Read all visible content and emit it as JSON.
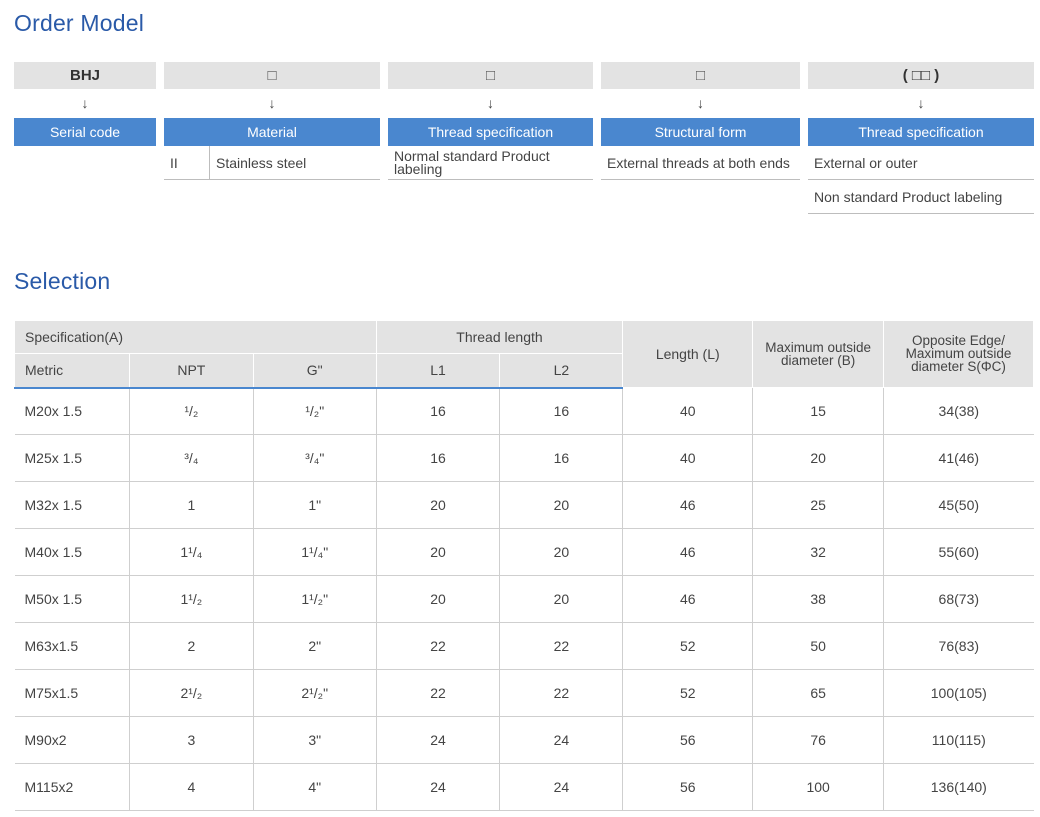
{
  "order_model": {
    "title": "Order Model",
    "columns": [
      {
        "code": "BHJ",
        "arrow": "↓",
        "header": "Serial code",
        "rows": []
      },
      {
        "code": "□",
        "arrow": "↓",
        "header": "Material",
        "rows": [
          {
            "key": "II",
            "value": "Stainless steel"
          }
        ]
      },
      {
        "code": "□",
        "arrow": "↓",
        "header": "Thread specification",
        "rows": [
          {
            "value": "Normal standard Product labeling"
          }
        ]
      },
      {
        "code": "□",
        "arrow": "↓",
        "header": "Structural form",
        "rows": [
          {
            "value": "External threads at both ends"
          }
        ]
      },
      {
        "code": "( □□ )",
        "arrow": "↓",
        "header": "Thread specification",
        "rows": [
          {
            "value": "External or outer"
          },
          {
            "value": "Non standard Product labeling"
          }
        ]
      }
    ]
  },
  "selection": {
    "title": "Selection",
    "headers": {
      "spec": "Specification(A)",
      "thread_length": "Thread length",
      "length": "Length (L)",
      "max_outside": "Maximum outside diameter (B)",
      "opposite": "Opposite Edge/ Maximum outside diameter S(ΦC)",
      "metric": "Metric",
      "npt": "NPT",
      "g": "G\"",
      "l1": "L1",
      "l2": "L2"
    },
    "rows": [
      {
        "metric": "M20x 1.5",
        "npt": "¹/₂",
        "g": "¹/₂\"",
        "l1": "16",
        "l2": "16",
        "length": "40",
        "b": "15",
        "s": "34(38)"
      },
      {
        "metric": "M25x 1.5",
        "npt": "³/₄",
        "g": "³/₄\"",
        "l1": "16",
        "l2": "16",
        "length": "40",
        "b": "20",
        "s": "41(46)"
      },
      {
        "metric": "M32x 1.5",
        "npt": "1",
        "g": "1\"",
        "l1": "20",
        "l2": "20",
        "length": "46",
        "b": "25",
        "s": "45(50)"
      },
      {
        "metric": "M40x 1.5",
        "npt": "1¹/₄",
        "g": "1¹/₄\"",
        "l1": "20",
        "l2": "20",
        "length": "46",
        "b": "32",
        "s": "55(60)"
      },
      {
        "metric": "M50x 1.5",
        "npt": "1¹/₂",
        "g": "1¹/₂\"",
        "l1": "20",
        "l2": "20",
        "length": "46",
        "b": "38",
        "s": "68(73)"
      },
      {
        "metric": "M63x1.5",
        "npt": "2",
        "g": "2\"",
        "l1": "22",
        "l2": "22",
        "length": "52",
        "b": "50",
        "s": "76(83)"
      },
      {
        "metric": "M75x1.5",
        "npt": "2¹/₂",
        "g": "2¹/₂\"",
        "l1": "22",
        "l2": "22",
        "length": "52",
        "b": "65",
        "s": "100(105)"
      },
      {
        "metric": "M90x2",
        "npt": "3",
        "g": "3\"",
        "l1": "24",
        "l2": "24",
        "length": "56",
        "b": "76",
        "s": "110(115)"
      },
      {
        "metric": "M115x2",
        "npt": "4",
        "g": "4\"",
        "l1": "24",
        "l2": "24",
        "length": "56",
        "b": "100",
        "s": "136(140)"
      }
    ]
  }
}
